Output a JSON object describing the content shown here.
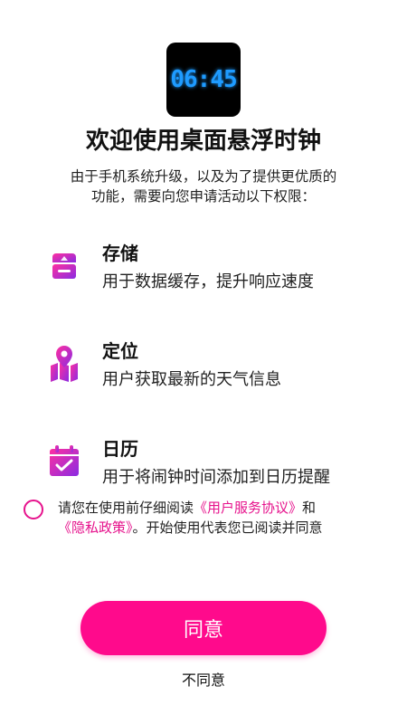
{
  "app_icon": {
    "clock_text": "06:45",
    "clock_color": "#1e9bff"
  },
  "title": "欢迎使用桌面悬浮时钟",
  "intro": {
    "line1": "由于手机系统升级，以及为了提供更优质的",
    "line2": "功能，需要向您申请活动以下权限："
  },
  "permissions": [
    {
      "name": "存储",
      "description": "用于数据缓存，提升响应速度",
      "icon": "storage-icon"
    },
    {
      "name": "定位",
      "description": "用户获取最新的天气信息",
      "icon": "location-icon"
    },
    {
      "name": "日历",
      "description": "用于将闹钟时间添加到日历提醒",
      "icon": "calendar-icon"
    }
  ],
  "agreement": {
    "prefix": "请您在使用前仔细阅读",
    "user_agreement": "《用户服务协议》",
    "and": "和",
    "privacy_policy": "《隐私政策》",
    "suffix": "。开始使用代表您已阅读并同意"
  },
  "buttons": {
    "agree": "同意",
    "disagree": "不同意"
  },
  "colors": {
    "accent": "#ff0a8c",
    "icon_gradient_start": "#ff2fa0",
    "icon_gradient_end": "#8a2be2"
  }
}
